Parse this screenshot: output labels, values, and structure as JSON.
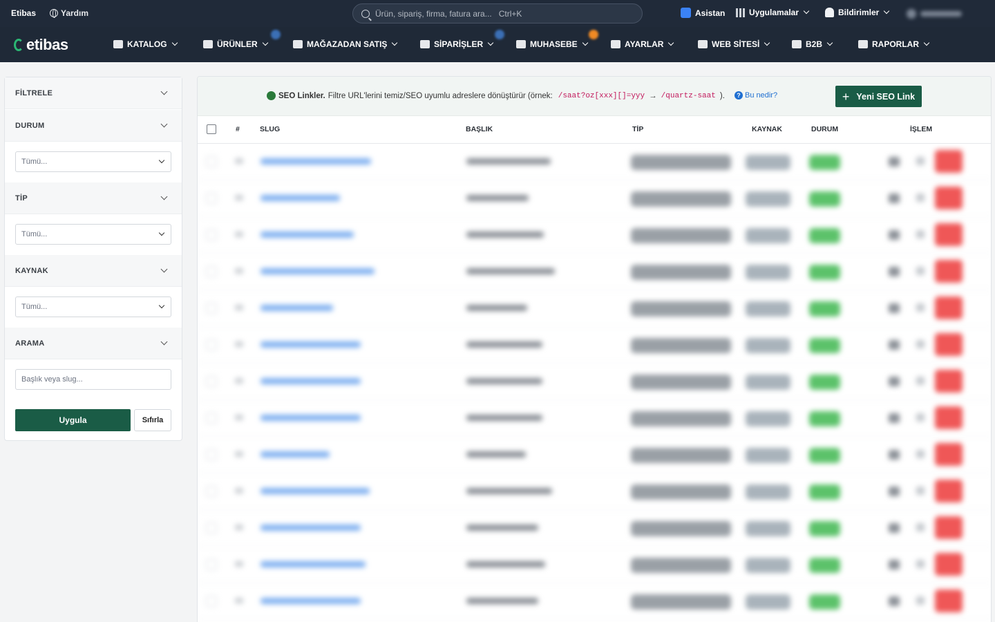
{
  "topbar": {
    "brand": "Etibas",
    "help_label": "Yardım",
    "search_placeholder": "Ürün, sipariş, firma, fatura ara...   Ctrl+K",
    "assistant_label": "Asistan",
    "apps_label": "Uygulamalar",
    "notifications_label": "Bildirimler"
  },
  "nav": {
    "logo_text": "etibas",
    "items": [
      {
        "label": "KATALOG",
        "icon": "books-icon"
      },
      {
        "label": "ÜRÜNLER",
        "icon": "tag-icon"
      },
      {
        "label": "MAĞAZADAN SATIŞ",
        "icon": "cash-register-icon"
      },
      {
        "label": "SİPARİŞLER",
        "icon": "cart-icon"
      },
      {
        "label": "MUHASEBE",
        "icon": "calculator-icon"
      },
      {
        "label": "AYARLAR",
        "icon": "gear-icon"
      },
      {
        "label": "WEB SİTESİ",
        "icon": "globe-icon"
      },
      {
        "label": "B2B",
        "icon": "store-icon"
      },
      {
        "label": "RAPORLAR",
        "icon": "report-icon"
      }
    ]
  },
  "sidebar": {
    "filter_title": "FİLTRELE",
    "status_title": "DURUM",
    "status_value": "Tümü...",
    "type_title": "TİP",
    "type_value": "Tümü...",
    "source_title": "KAYNAK",
    "source_value": "Tümü...",
    "search_title": "ARAMA",
    "search_placeholder": "Başlık veya slug...",
    "apply_label": "Uygula",
    "reset_label": "Sıfırla"
  },
  "info": {
    "title": "SEO Linkler.",
    "text": "Filtre URL'lerini temiz/SEO uyumlu adreslere dönüştürür (örnek:",
    "code_from": "/saat?oz[xxx][]=yyy",
    "arrow": "→",
    "code_to": "/quartz-saat",
    "close": ").",
    "help_link": "Bu nedir?",
    "new_button": "Yeni SEO Link"
  },
  "table": {
    "headers": {
      "num": "#",
      "slug": "SLUG",
      "title": "BAŞLIK",
      "type": "TİP",
      "source": "KAYNAK",
      "status": "DURUM",
      "action": "İŞLEM"
    },
    "row_count": 13
  },
  "colors": {
    "topbar": "#202a39",
    "navbar": "#1f2937",
    "accent_green": "#1a5c46",
    "status_green": "#5cc26a",
    "delete_red": "#ef5757",
    "link_blue": "#1f6fd1"
  }
}
